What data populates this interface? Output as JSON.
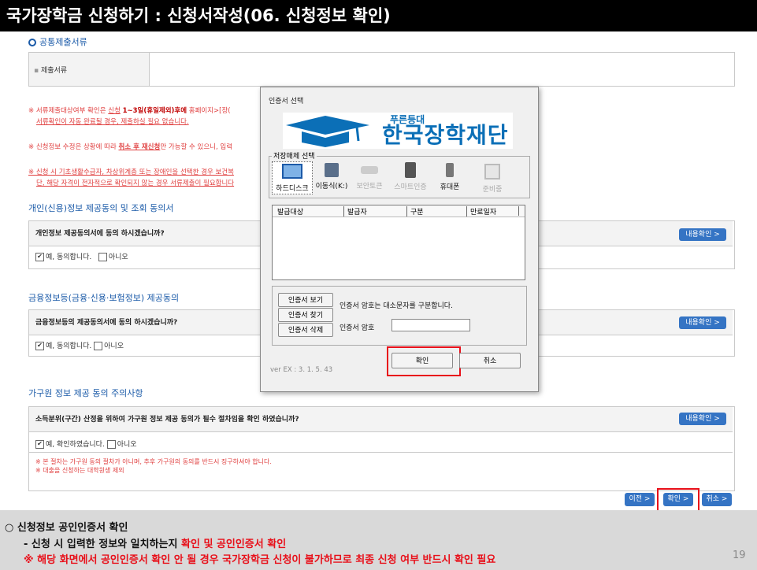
{
  "slide": {
    "title": "국가장학금 신청하기 : 신청서작성(06. 신청정보 확인)",
    "page_number": "19"
  },
  "form": {
    "section_header": "공통제출서류",
    "submit_docs_label": "제출서류",
    "note1_line1_pre": "※ 서류제출대상여부 확인은 ",
    "note1_line1_link": "신청",
    "note1_line1_bold": "1~3일(휴일제외)후에",
    "note1_line1_post": " 홈페이지>[장(",
    "note1_line2": "서류확인이 자동 완료될 경우, 제출하실 필요 없습니다.",
    "note2_pre": "※ 신청정보 수정은 상황에 따라 ",
    "note2_bold": "취소 후 재신청",
    "note2_post": "만 가능할 수 있으니, 입력",
    "note3_line1": "※ 신청 시 기초생활수급자, 차상위계층 또는 장애인을 선택한 경우 보건복",
    "note3_line2": "단, 해당 자격이 전자적으로 확인되지 않는 경우 서류제출이 필요합니다",
    "privacy_heading": "개인(신용)정보 제공동의 및 조회 동의서",
    "privacy_question": "개인정보 제공동의서에 동의 하시겠습니까?",
    "privacy_yes": "예, 동의합니다.",
    "privacy_no": "아니오",
    "view_content": "내용확인 >",
    "finance_heading": "금융정보등(금융·신용·보험정보) 제공동의",
    "finance_question": "금융정보등의 제공동의서에 동의 하시겠습니까?",
    "finance_yes": "예, 동의합니다.",
    "finance_no": "아니오",
    "household_heading": "가구원 정보 제공 동의 주의사항",
    "household_question": "소득분위(구간) 산정을 위하여 가구원 정보 제공 동의가 필수 절차임을 확인 하였습니까?",
    "household_yes": "예, 확인하였습니다.",
    "household_no": "아니오",
    "household_note1": "※ 본 절차는 가구원 동의 절차가 아니며, 추후 가구원의 동의를 반드시 징구하셔야 합니다.",
    "household_note2": "※ 대출을 신청하는 대학원생 제외",
    "btn_prev": "이전 >",
    "btn_confirm": "확인 >",
    "btn_cancel": "취소 >"
  },
  "dialog": {
    "title": "인증서 선택",
    "banner_small": "푸른등대",
    "banner_big": "한국장학재단",
    "storage_label": "저장매체 선택",
    "media": [
      "하드디스크",
      "이동식(K:)",
      "보안토큰",
      "스마트인증",
      "휴대폰",
      "준비중"
    ],
    "columns": [
      "발급대상",
      "발급자",
      "구분",
      "만료일자"
    ],
    "btn_view": "인증서 보기",
    "btn_find": "인증서 찾기",
    "btn_delete": "인증서 삭제",
    "case_notice": "인증서 암호는 대소문자를 구분합니다.",
    "password_label": "인증서 암호",
    "password_value": "",
    "btn_ok": "확인",
    "btn_cancel": "취소",
    "version": "ver EX : 3. 1. 5. 43"
  },
  "footer": {
    "line1": "○ 신청정보 공인인증서 확인",
    "line2_pre": "- 신청 시 입력한 정보와 일치하는지 ",
    "line2_red": "확인 및 공인인증서 확인",
    "line3": "※ 해당 화면에서 공인인증서 확인 안 될 경우 국가장학금 신청이 불가하므로 최종 신청 여부 반드시 확인 필요"
  },
  "colors": {
    "accent_blue": "#3574c4",
    "highlight_red": "#e8101a",
    "title_bg": "#000000",
    "footer_bg": "#d9d9d9"
  }
}
